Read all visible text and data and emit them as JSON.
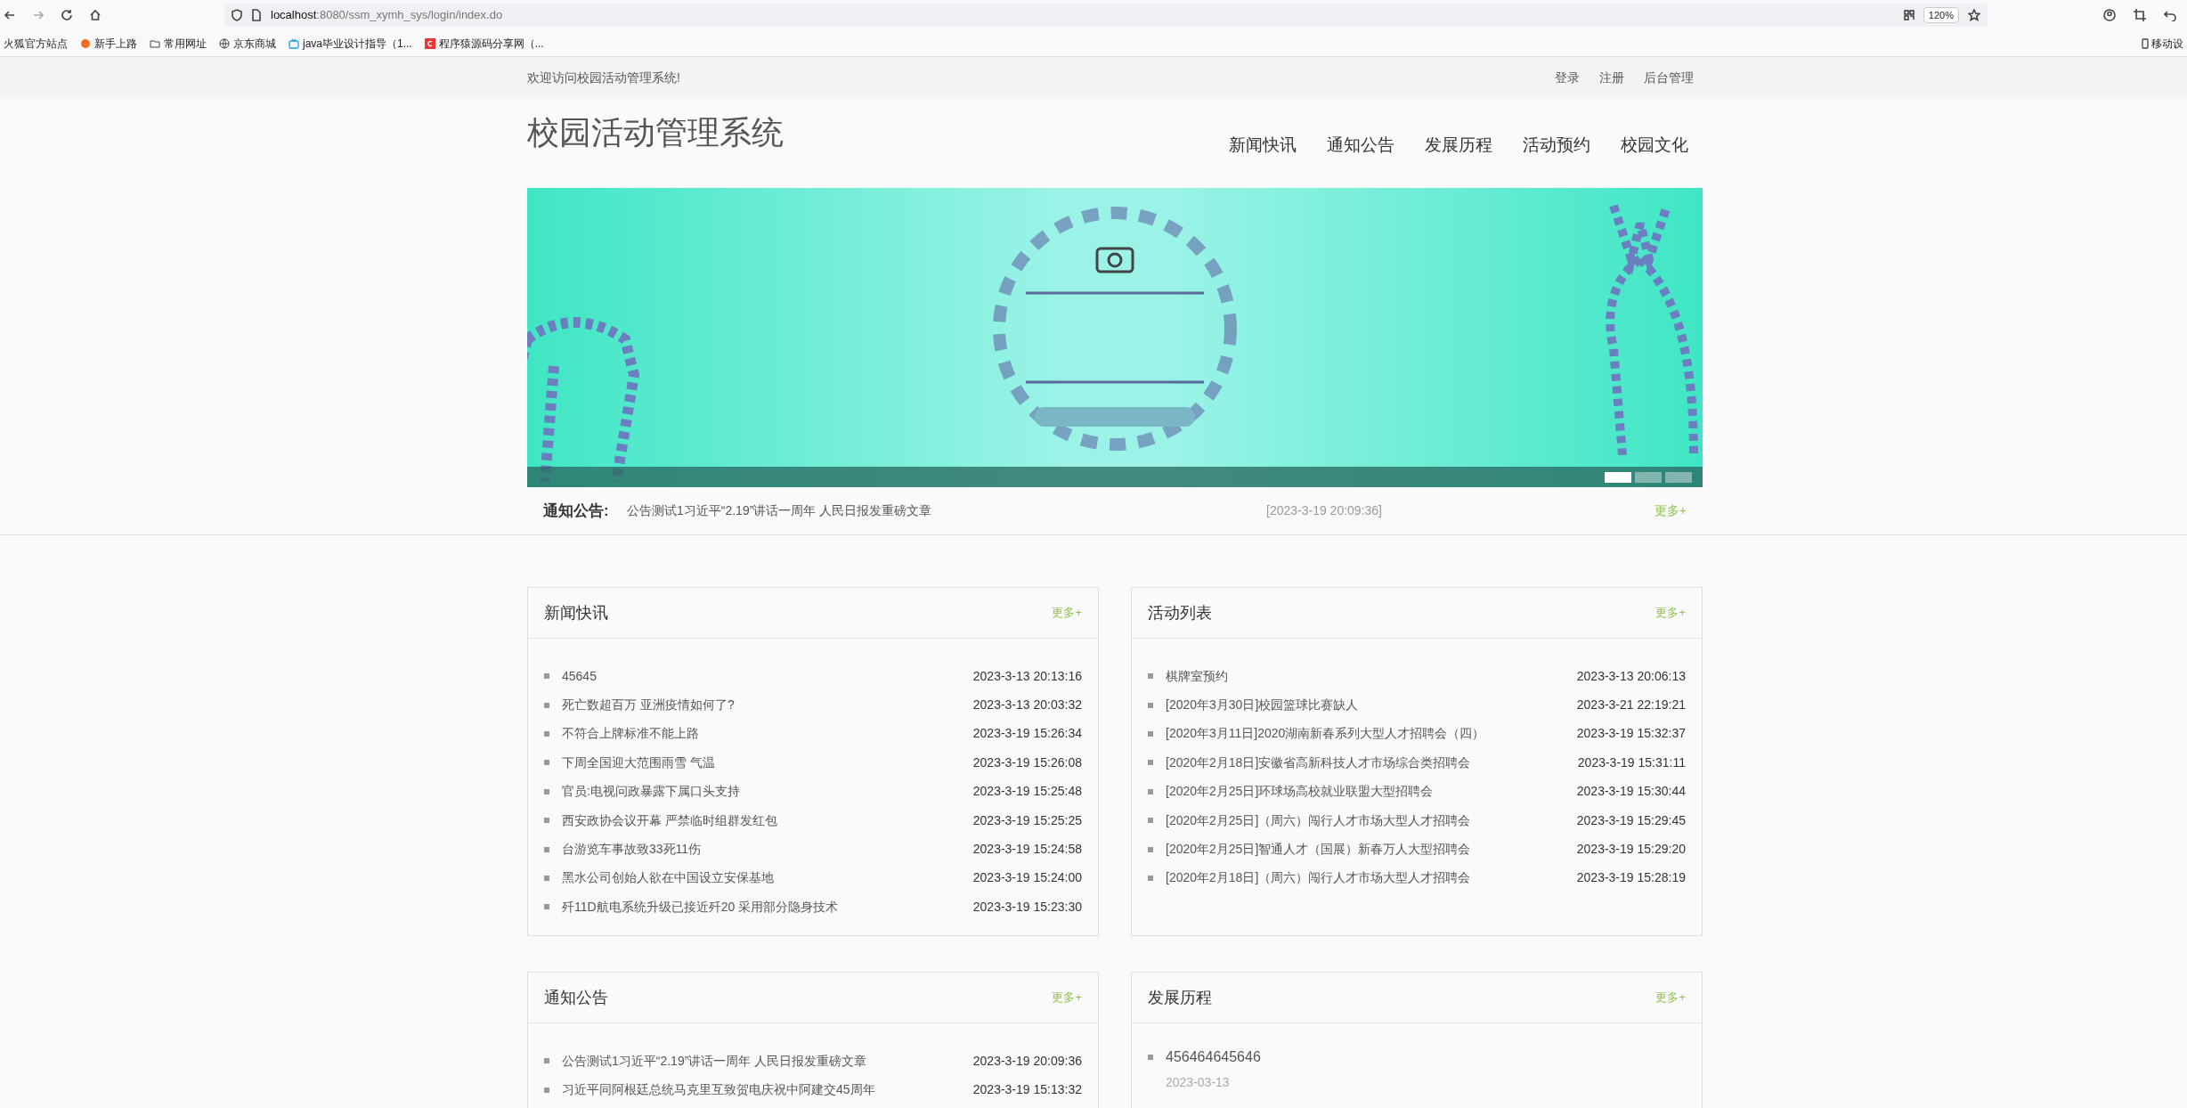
{
  "browser": {
    "address": {
      "host": "localhost",
      "rest": ":8080/ssm_xymh_sys/login/index.do"
    },
    "zoom": "120%",
    "bookmarks": [
      "火狐官方站点",
      "新手上路",
      "常用网址",
      "京东商城",
      "java毕业设计指导（1...",
      "程序猿源码分享网（..."
    ],
    "mobile_bookmark": "移动设"
  },
  "topbar": {
    "welcome": "欢迎访问校园活动管理系统!",
    "links": [
      "登录",
      "注册",
      "后台管理"
    ]
  },
  "header": {
    "title": "校园活动管理系统",
    "nav": [
      "新闻快讯",
      "通知公告",
      "发展历程",
      "活动预约",
      "校园文化"
    ]
  },
  "banner": {
    "slides": [
      {
        "selected": true
      },
      {
        "selected": false
      },
      {
        "selected": false
      }
    ]
  },
  "notice_bar": {
    "label": "通知公告:",
    "text": "公告测试1习近平“2.19”讲话一周年 人民日报发重磅文章",
    "time": "[2023-3-19 20:09:36]",
    "more": "更多+"
  },
  "panels": [
    {
      "kind": "list",
      "title": "新闻快讯",
      "more": "更多+",
      "items": [
        {
          "text": "45645",
          "time": "2023-3-13 20:13:16"
        },
        {
          "text": "死亡数超百万 亚洲疫情如何了?",
          "time": "2023-3-13 20:03:32"
        },
        {
          "text": "不符合上牌标准不能上路",
          "time": "2023-3-19 15:26:34"
        },
        {
          "text": "下周全国迎大范围雨雪 气温",
          "time": "2023-3-19 15:26:08"
        },
        {
          "text": "官员:电视问政暴露下属口头支持",
          "time": "2023-3-19 15:25:48"
        },
        {
          "text": "西安政协会议开幕 严禁临时组群发红包",
          "time": "2023-3-19 15:25:25"
        },
        {
          "text": "台游览车事故致33死11伤",
          "time": "2023-3-19 15:24:58"
        },
        {
          "text": "黑水公司创始人欲在中国设立安保基地",
          "time": "2023-3-19 15:24:00"
        },
        {
          "text": "歼11D航电系统升级已接近歼20 采用部分隐身技术",
          "time": "2023-3-19 15:23:30"
        }
      ]
    },
    {
      "kind": "list",
      "title": "活动列表",
      "more": "更多+",
      "items": [
        {
          "text": "棋牌室预约",
          "time": "2023-3-13 20:06:13"
        },
        {
          "text": "[2020年3月30日]校园篮球比赛缺人",
          "time": "2023-3-21 22:19:21"
        },
        {
          "text": "[2020年3月11日]2020湖南新春系列大型人才招聘会（四）",
          "time": "2023-3-19 15:32:37"
        },
        {
          "text": "[2020年2月18日]安徽省高新科技人才市场综合类招聘会",
          "time": "2023-3-19 15:31:11"
        },
        {
          "text": "[2020年2月25日]环球场高校就业联盟大型招聘会",
          "time": "2023-3-19 15:30:44"
        },
        {
          "text": "[2020年2月25日]（周六）闯行人才市场大型人才招聘会",
          "time": "2023-3-19 15:29:45"
        },
        {
          "text": "[2020年2月25日]智通人才（国展）新春万人大型招聘会",
          "time": "2023-3-19 15:29:20"
        },
        {
          "text": "[2020年2月18日]（周六）闯行人才市场大型人才招聘会",
          "time": "2023-3-19 15:28:19"
        }
      ]
    },
    {
      "kind": "list",
      "title": "通知公告",
      "more": "更多+",
      "items": [
        {
          "text": "公告测试1习近平“2.19”讲话一周年 人民日报发重磅文章",
          "time": "2023-3-19 20:09:36"
        },
        {
          "text": "习近平同阿根廷总统马克里互致贺电庆祝中阿建交45周年",
          "time": "2023-3-19 15:13:32"
        }
      ]
    },
    {
      "kind": "timeline",
      "title": "发展历程",
      "more": "更多+",
      "items": [
        {
          "text": "456464645646",
          "time": "2023-03-13"
        }
      ]
    }
  ]
}
